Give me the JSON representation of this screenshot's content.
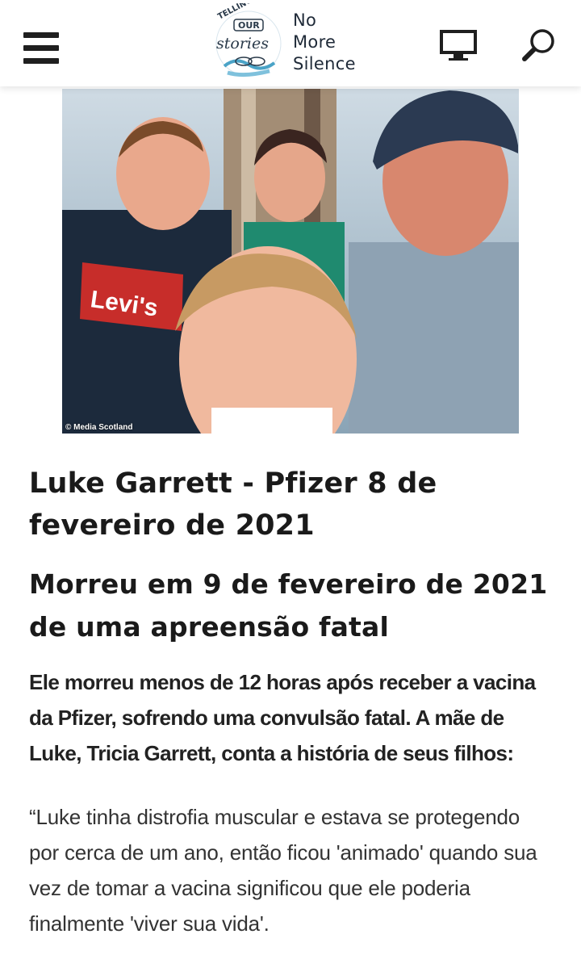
{
  "header": {
    "menu_icon": "hamburger-menu-icon",
    "logo": {
      "badge_top": "TELLING",
      "badge_mid": "OUR",
      "badge_script": "stories",
      "site_name_lines": [
        "No",
        "More",
        "Silence"
      ]
    },
    "monitor_icon": "monitor-icon",
    "search_icon": "search-icon"
  },
  "hero": {
    "credit": "© Media Scotland",
    "shirt_logo": "Levi's"
  },
  "article": {
    "title": "Luke Garrett - Pfizer 8 de fevereiro de 2021",
    "subtitle": "Morreu em 9 de fevereiro de 2021 de uma apreensão fatal",
    "lead": "Ele morreu menos de 12 horas após receber a vacina da Pfizer, sofrendo uma convulsão fatal. A mãe de Luke, Tricia Garrett, conta a história de seus filhos:",
    "quote": "“Luke tinha distrofia muscular e estava se protegendo por cerca de um ano, então ficou 'animado' quando sua vez de tomar a vacina significou que ele poderia finalmente 'viver sua vida'."
  },
  "colors": {
    "text": "#1a1a1a",
    "logo_blue": "#4aa3c7",
    "icon_dark": "#1f1f1f"
  }
}
